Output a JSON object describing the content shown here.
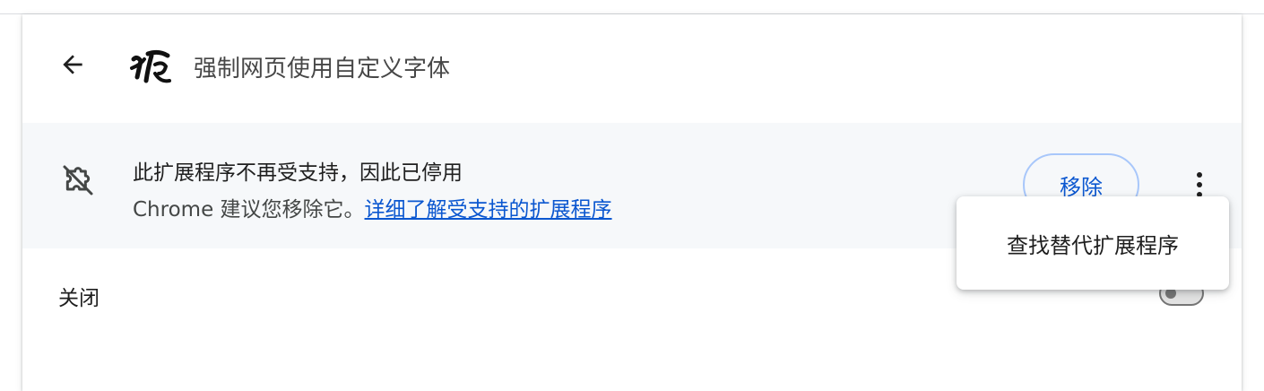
{
  "header": {
    "back_icon": "arrow-left-icon",
    "logo_icon": "calligraphy-logo-icon",
    "title": "强制网页使用自定义字体"
  },
  "warning": {
    "icon": "extension-off-icon",
    "title": "此扩展程序不再受支持，因此已停用",
    "message": "Chrome 建议您移除它。",
    "link_text": "详细了解受支持的扩展程序",
    "remove_label": "移除",
    "more_icon": "more-vert-icon"
  },
  "toggle": {
    "label": "关闭",
    "state": "off"
  },
  "menu": {
    "items": [
      {
        "label": "查找替代扩展程序"
      }
    ]
  },
  "colors": {
    "accent": "#0b57d0",
    "warning_bg": "#f6f8fa",
    "button_border": "#a8c7fa"
  }
}
